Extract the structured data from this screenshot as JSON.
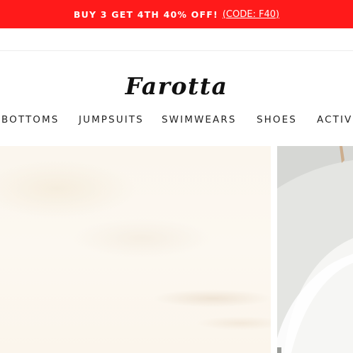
{
  "promo": {
    "text": "BUY 3 GET 4TH 40% OFF!",
    "code_link": "(CODE: F40)"
  },
  "brand": {
    "logo": "Farotta"
  },
  "nav": {
    "items": [
      "BOTTOMS",
      "JUMPSUITS",
      "SWIMWEARS",
      "SHOES",
      "ACTIVE"
    ]
  },
  "colors": {
    "promo_background": "#ff1a1a",
    "promo_text": "#ffffff",
    "nav_text": "#222222",
    "logo_text": "#111111"
  }
}
